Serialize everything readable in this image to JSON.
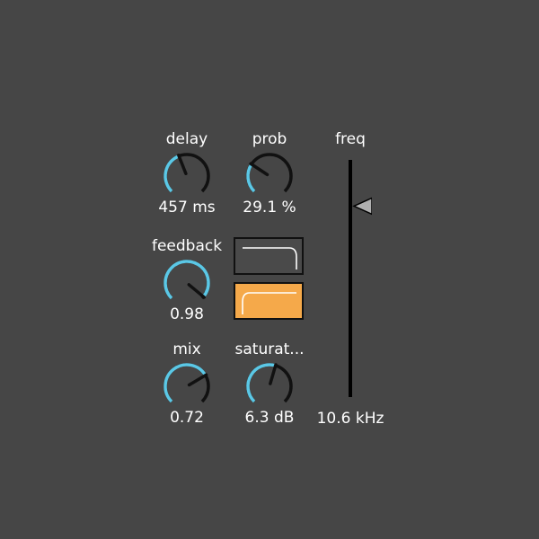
{
  "controls": {
    "delay": {
      "label": "delay",
      "value_text": "457 ms",
      "fraction": 0.42
    },
    "prob": {
      "label": "prob",
      "value_text": "29.1 %",
      "fraction": 0.29
    },
    "feedback": {
      "label": "feedback",
      "value_text": "0.98",
      "fraction": 0.98
    },
    "mix": {
      "label": "mix",
      "value_text": "0.72",
      "fraction": 0.72
    },
    "saturation": {
      "label": "saturat...",
      "value_text": "6.3 dB",
      "fraction": 0.56
    }
  },
  "filter_modes": [
    {
      "name": "lowpass",
      "selected": false
    },
    {
      "name": "highpass",
      "selected": true
    }
  ],
  "freq": {
    "label": "freq",
    "value_text": "10.6 kHz",
    "fraction": 0.82
  },
  "colors": {
    "background": "#464646",
    "accent": "#5bc8e6",
    "knob_track": "#111111",
    "selected": "#f5a94a",
    "unselected": "#4a4a4a",
    "text": "#ffffff"
  },
  "icons": {
    "lowpass_button": "lowpass-curve-icon",
    "highpass_button": "highpass-curve-icon",
    "slider_thumb": "triangle-pointer-icon"
  }
}
